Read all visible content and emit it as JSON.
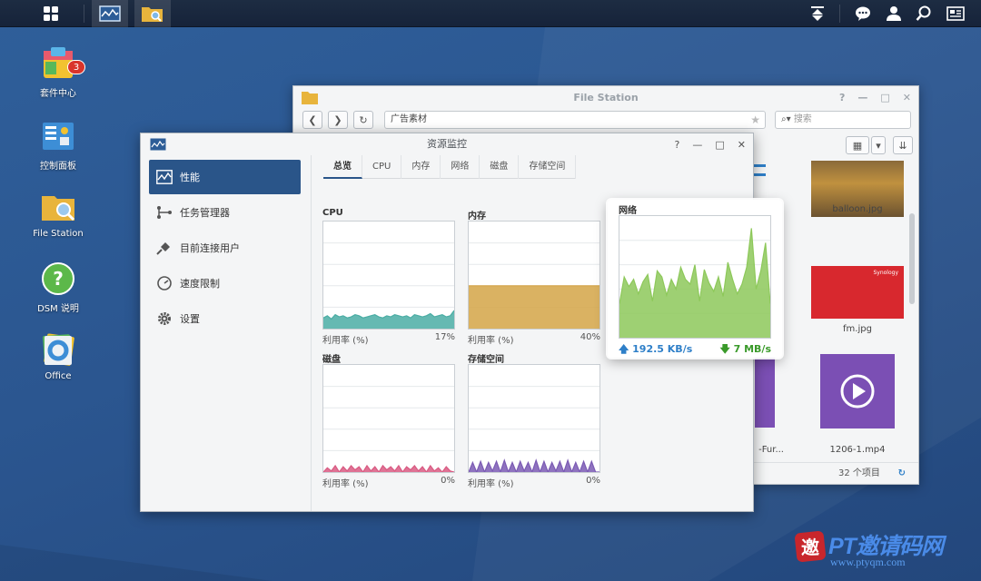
{
  "taskbar": {
    "apps": [
      "main-menu",
      "resource-monitor",
      "file-station"
    ],
    "tray": [
      "upload-icon",
      "chat-icon",
      "user-icon",
      "search-icon",
      "widgets-icon"
    ]
  },
  "desktop": {
    "icons": [
      {
        "label": "套件中心",
        "badge": "3"
      },
      {
        "label": "控制面板"
      },
      {
        "label": "File Station"
      },
      {
        "label": "DSM 说明"
      },
      {
        "label": "Office"
      }
    ]
  },
  "file_station": {
    "title": "File Station",
    "path": "广告素材",
    "search_placeholder": "搜索",
    "files": [
      {
        "name": "balloon.jpg"
      },
      {
        "name": "fm.jpg"
      },
      {
        "name": "-Fur..."
      },
      {
        "name": "1206-1.mp4"
      }
    ],
    "footer_count": "32 个项目",
    "window_controls": [
      "?",
      "—",
      "□",
      "✕"
    ]
  },
  "resource_monitor": {
    "title": "资源监控",
    "sidebar": [
      {
        "label": "性能",
        "active": true
      },
      {
        "label": "任务管理器"
      },
      {
        "label": "目前连接用户"
      },
      {
        "label": "速度限制"
      },
      {
        "label": "设置"
      }
    ],
    "tabs": [
      {
        "label": "总览",
        "active": true
      },
      {
        "label": "CPU"
      },
      {
        "label": "内存"
      },
      {
        "label": "网络"
      },
      {
        "label": "磁盘"
      },
      {
        "label": "存储空间"
      }
    ],
    "window_controls": [
      "?",
      "—",
      "□",
      "✕"
    ],
    "usage_label": "利用率 (%)"
  },
  "chart_data": [
    {
      "type": "area",
      "title": "CPU",
      "color": "#4aada4",
      "footer_label": "利用率 (%)",
      "footer_value": "17%",
      "ylim": [
        0,
        100
      ],
      "values": [
        10,
        12,
        9,
        13,
        11,
        12,
        10,
        11,
        13,
        12,
        10,
        11,
        12,
        13,
        11,
        10,
        12,
        11,
        13,
        12,
        11,
        12,
        10,
        13,
        12,
        11,
        12,
        14,
        11,
        12,
        13,
        11,
        12,
        17
      ]
    },
    {
      "type": "area",
      "title": "内存",
      "color": "#d4a447",
      "footer_label": "利用率 (%)",
      "footer_value": "40%",
      "ylim": [
        0,
        100
      ],
      "values": [
        40,
        40,
        40,
        40,
        40,
        40,
        40,
        40,
        40,
        40,
        40,
        40,
        40,
        40,
        40,
        40,
        40,
        40,
        40,
        40,
        40,
        40,
        40,
        40,
        40,
        40,
        40,
        40,
        40,
        40,
        40,
        40,
        40,
        40
      ]
    },
    {
      "type": "area",
      "title": "磁盘",
      "color": "#d95a82",
      "footer_label": "利用率 (%)",
      "footer_value": "0%",
      "ylim": [
        0,
        100
      ],
      "values": [
        0,
        4,
        1,
        6,
        0,
        5,
        1,
        6,
        2,
        5,
        0,
        6,
        1,
        5,
        0,
        6,
        2,
        5,
        1,
        6,
        0,
        5,
        2,
        6,
        1,
        5,
        0,
        6,
        1,
        4,
        0,
        5,
        1,
        0
      ]
    },
    {
      "type": "area",
      "title": "存储空间",
      "color": "#7b5bb4",
      "footer_label": "利用率 (%)",
      "footer_value": "0%",
      "ylim": [
        0,
        100
      ],
      "values": [
        0,
        9,
        0,
        10,
        0,
        9,
        1,
        10,
        0,
        11,
        0,
        9,
        0,
        10,
        1,
        9,
        0,
        11,
        0,
        10,
        0,
        9,
        1,
        10,
        0,
        11,
        0,
        9,
        0,
        10,
        0,
        10,
        0,
        0
      ]
    },
    {
      "type": "area",
      "title": "网络",
      "color": "#8dc85a",
      "upload": "192.5 KB/s",
      "download": "7 MB/s",
      "ylim": [
        0,
        100
      ],
      "values": [
        28,
        50,
        42,
        48,
        36,
        46,
        52,
        30,
        55,
        50,
        35,
        48,
        40,
        58,
        48,
        44,
        60,
        30,
        56,
        45,
        38,
        50,
        34,
        62,
        48,
        36,
        44,
        58,
        90,
        40,
        55,
        78,
        28
      ]
    }
  ],
  "watermark": {
    "brand": "PT邀请码网",
    "url": "www.ptyqm.com",
    "seal": "邀"
  }
}
